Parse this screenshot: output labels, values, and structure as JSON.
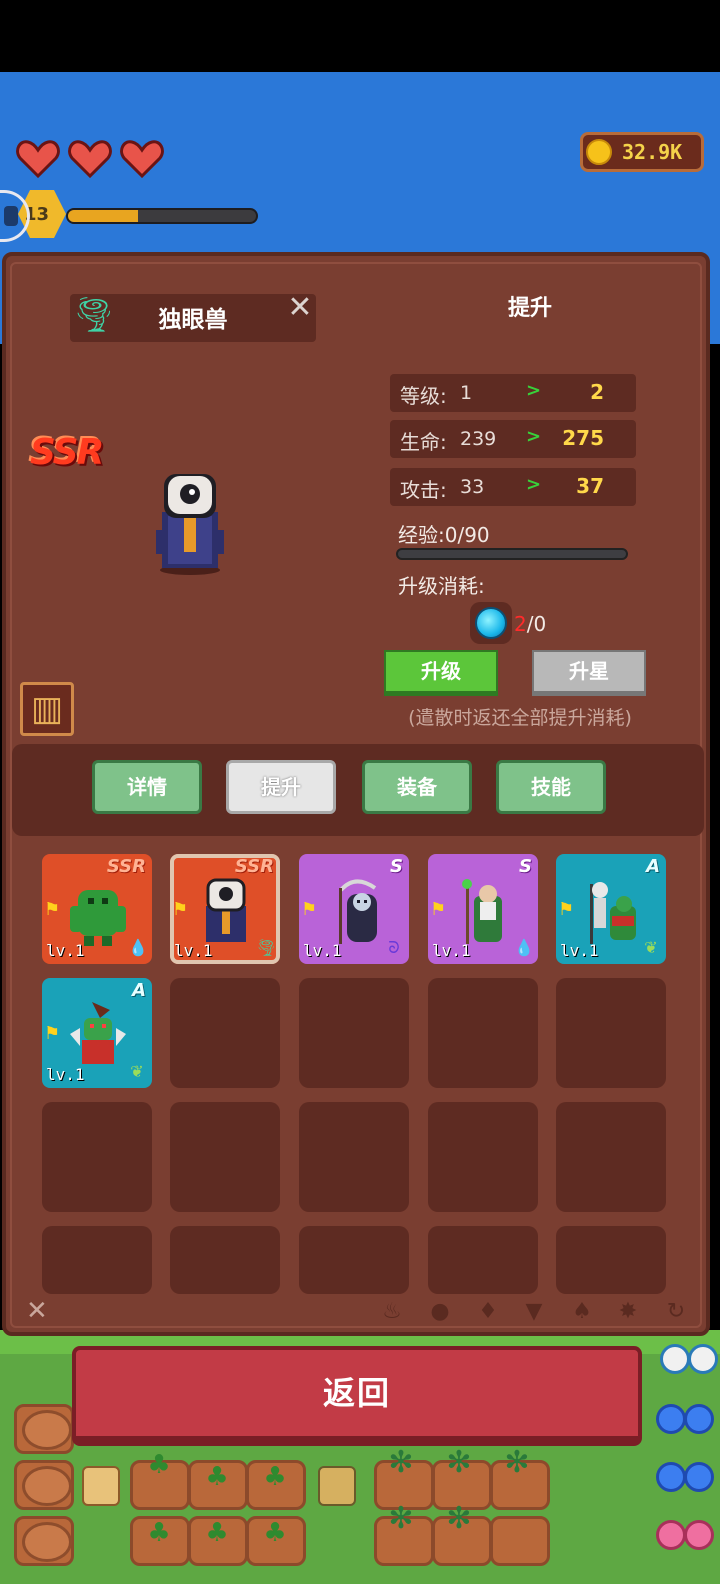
{
  "hud": {
    "hearts": 3,
    "gold": "32.9K",
    "player_level": "13",
    "xp_progress": 0.37
  },
  "panel": {
    "hero_name": "独眼兽",
    "hero_rarity": "SSR",
    "section_title": "提升",
    "stats": [
      {
        "label": "等级:",
        "current": "1",
        "arrow": ">",
        "next": "2"
      },
      {
        "label": "生命:",
        "current": "239",
        "arrow": ">",
        "next": "275"
      },
      {
        "label": "攻击:",
        "current": "33",
        "arrow": ">",
        "next": "37"
      }
    ],
    "exp_label": "经验:0/90",
    "exp_progress": 0,
    "cost_label": "升级消耗:",
    "cost_have": "2",
    "cost_need": "/0",
    "upgrade_button": "升级",
    "star_button": "升星",
    "note": "(遣散时返还全部提升消耗)"
  },
  "tabs": [
    {
      "label": "详情",
      "active": false
    },
    {
      "label": "提升",
      "active": true
    },
    {
      "label": "装备",
      "active": false
    },
    {
      "label": "技能",
      "active": false
    }
  ],
  "roster": [
    {
      "rank": "SSR",
      "level": "lv.1",
      "element": "water",
      "color": "#df4f28",
      "selected": false
    },
    {
      "rank": "SSR",
      "level": "lv.1",
      "element": "wind",
      "color": "#df4f28",
      "selected": true
    },
    {
      "rank": "S",
      "level": "lv.1",
      "element": "wind",
      "color": "#b963d8",
      "selected": false
    },
    {
      "rank": "S",
      "level": "lv.1",
      "element": "water",
      "color": "#b963d8",
      "selected": false
    },
    {
      "rank": "A",
      "level": "lv.1",
      "element": "leaf",
      "color": "#1aa2b8",
      "selected": false
    },
    {
      "rank": "A",
      "level": "lv.1",
      "element": "leaf",
      "color": "#1aa2b8",
      "selected": false
    }
  ],
  "back_button": "返回"
}
